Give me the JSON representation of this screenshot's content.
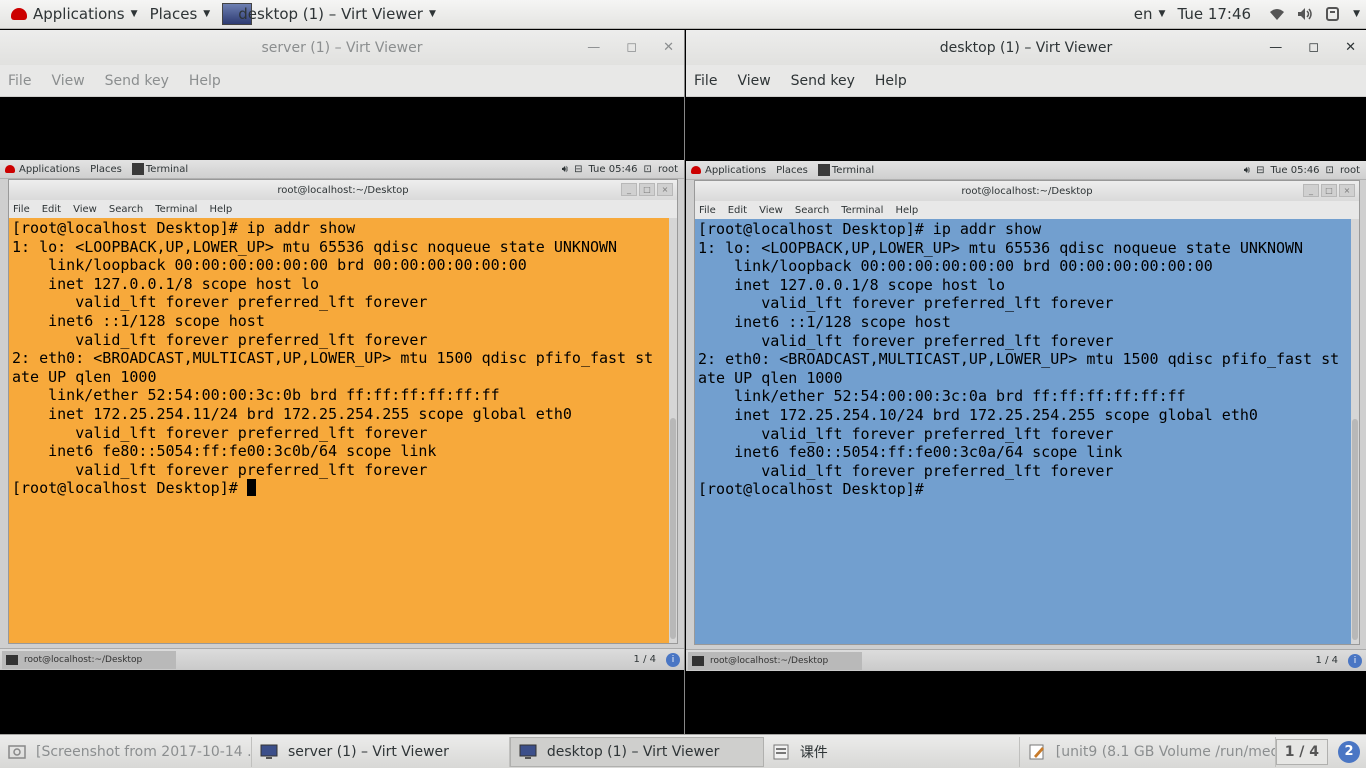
{
  "host_panel": {
    "applications": "Applications",
    "places": "Places",
    "active_window": "desktop (1) – Virt Viewer",
    "language": "en",
    "clock": "Tue 17:46"
  },
  "left_window": {
    "title": "server (1) – Virt Viewer",
    "menu": [
      "File",
      "View",
      "Send key",
      "Help"
    ],
    "guest_panel": {
      "applications": "Applications",
      "places": "Places",
      "task": "Terminal",
      "clock": "Tue 05:46",
      "user": "root"
    },
    "terminal": {
      "title": "root@localhost:~/Desktop",
      "menu": [
        "File",
        "Edit",
        "View",
        "Search",
        "Terminal",
        "Help"
      ],
      "lines": [
        "[root@localhost Desktop]# ip addr show",
        "1: lo: <LOOPBACK,UP,LOWER_UP> mtu 65536 qdisc noqueue state UNKNOWN",
        "    link/loopback 00:00:00:00:00:00 brd 00:00:00:00:00:00",
        "    inet 127.0.0.1/8 scope host lo",
        "       valid_lft forever preferred_lft forever",
        "    inet6 ::1/128 scope host",
        "       valid_lft forever preferred_lft forever",
        "2: eth0: <BROADCAST,MULTICAST,UP,LOWER_UP> mtu 1500 qdisc pfifo_fast st",
        "ate UP qlen 1000",
        "    link/ether 52:54:00:00:3c:0b brd ff:ff:ff:ff:ff:ff",
        "    inet 172.25.254.11/24 brd 172.25.254.255 scope global eth0",
        "       valid_lft forever preferred_lft forever",
        "    inet6 fe80::5054:ff:fe00:3c0b/64 scope link",
        "       valid_lft forever preferred_lft forever"
      ],
      "prompt": "[root@localhost Desktop]# ",
      "background": "#f7a93b"
    },
    "guest_taskbar": {
      "task": "root@localhost:~/Desktop",
      "workspace": "1 / 4"
    }
  },
  "right_window": {
    "title": "desktop (1) – Virt Viewer",
    "menu": [
      "File",
      "View",
      "Send key",
      "Help"
    ],
    "guest_panel": {
      "applications": "Applications",
      "places": "Places",
      "task": "Terminal",
      "clock": "Tue 05:46",
      "user": "root"
    },
    "terminal": {
      "title": "root@localhost:~/Desktop",
      "menu": [
        "File",
        "Edit",
        "View",
        "Search",
        "Terminal",
        "Help"
      ],
      "lines": [
        "[root@localhost Desktop]# ip addr show",
        "1: lo: <LOOPBACK,UP,LOWER_UP> mtu 65536 qdisc noqueue state UNKNOWN",
        "    link/loopback 00:00:00:00:00:00 brd 00:00:00:00:00:00",
        "    inet 127.0.0.1/8 scope host lo",
        "       valid_lft forever preferred_lft forever",
        "    inet6 ::1/128 scope host",
        "       valid_lft forever preferred_lft forever",
        "2: eth0: <BROADCAST,MULTICAST,UP,LOWER_UP> mtu 1500 qdisc pfifo_fast st",
        "ate UP qlen 1000",
        "    link/ether 52:54:00:00:3c:0a brd ff:ff:ff:ff:ff:ff",
        "    inet 172.25.254.10/24 brd 172.25.254.255 scope global eth0",
        "       valid_lft forever preferred_lft forever",
        "    inet6 fe80::5054:ff:fe00:3c0a/64 scope link",
        "       valid_lft forever preferred_lft forever"
      ],
      "prompt": "[root@localhost Desktop]#",
      "background": "#729fcf"
    },
    "guest_taskbar": {
      "task": "root@localhost:~/Desktop",
      "workspace": "1 / 4"
    }
  },
  "host_taskbar": {
    "tasks": [
      {
        "label": "[Screenshot from 2017-10-14 ...",
        "icon": "image-viewer-icon"
      },
      {
        "label": "server (1) – Virt Viewer",
        "icon": "virt-viewer-icon"
      },
      {
        "label": "desktop (1) – Virt Viewer",
        "icon": "virt-viewer-icon"
      },
      {
        "label": "课件",
        "icon": "file-manager-icon"
      },
      {
        "label": "[unit9 (8.1 GB Volume /run/medi...",
        "icon": "text-editor-icon"
      }
    ],
    "workspace": "1 / 4",
    "badge": "2"
  }
}
